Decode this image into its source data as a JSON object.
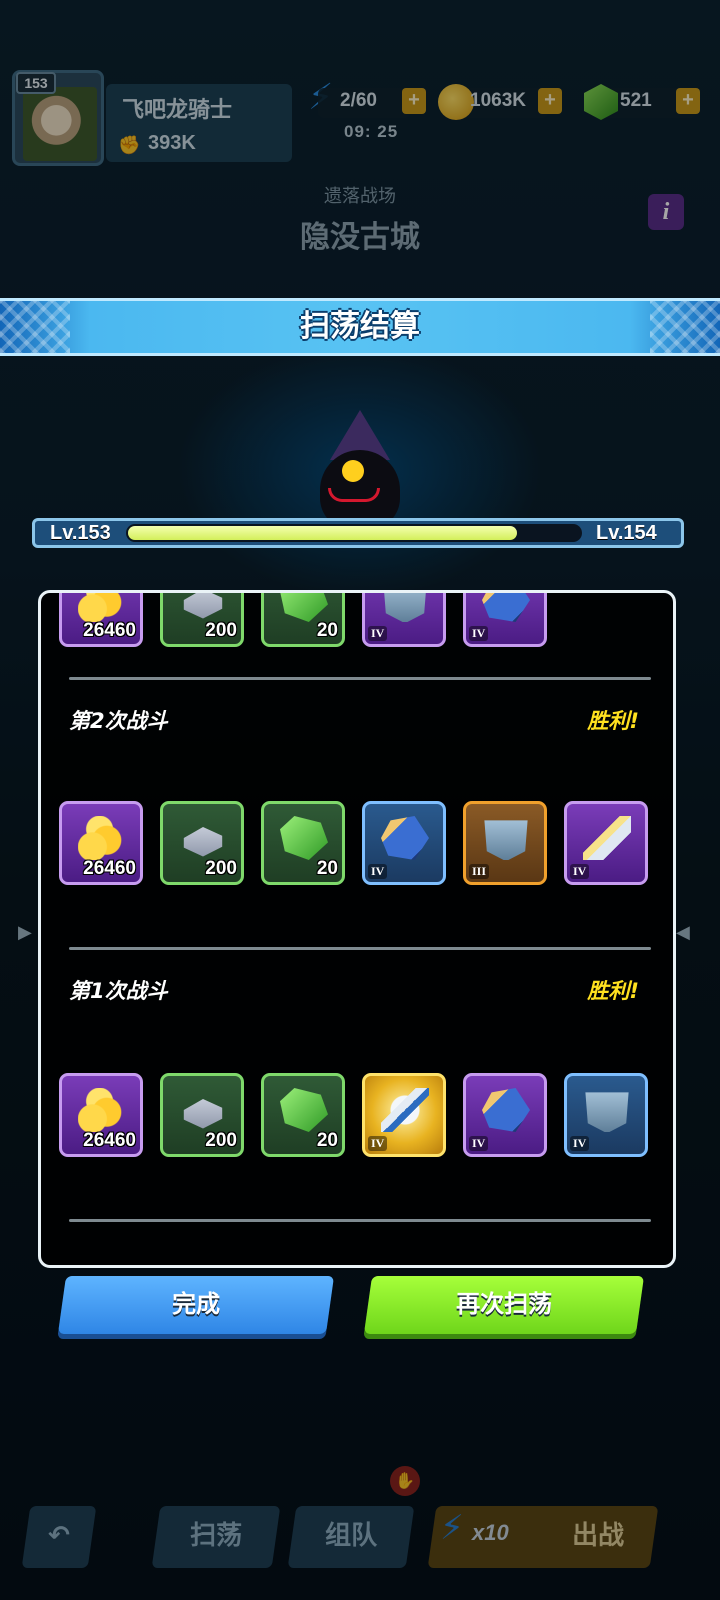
{
  "player": {
    "level": "153",
    "name": "飞吧龙骑士",
    "power": "393K"
  },
  "resources": {
    "energy": "2/60",
    "coins": "1063K",
    "gems": "521",
    "timer": "09: 25",
    "plus": "+"
  },
  "stage": {
    "category": "遗落战场",
    "name": "隐没古城"
  },
  "dialog": {
    "title": "扫荡结算",
    "xp": {
      "from": "Lv.153",
      "to": "Lv.154",
      "fill": 0.86
    },
    "battles": [
      {
        "label": "",
        "result": "",
        "items": [
          {
            "kind": "gold",
            "qty": "26460",
            "tier": ""
          },
          {
            "kind": "iron",
            "qty": "200",
            "tier": ""
          },
          {
            "kind": "gem",
            "qty": "20",
            "tier": ""
          },
          {
            "kind": "armor",
            "qty": "",
            "tier": "IV"
          },
          {
            "kind": "glove",
            "qty": "",
            "tier": "IV"
          }
        ]
      },
      {
        "label": "第2次战斗",
        "result": "胜利!",
        "items": [
          {
            "kind": "gold",
            "qty": "26460",
            "tier": ""
          },
          {
            "kind": "iron",
            "qty": "200",
            "tier": ""
          },
          {
            "kind": "gem",
            "qty": "20",
            "tier": ""
          },
          {
            "kind": "glove",
            "qty": "",
            "tier": "IV"
          },
          {
            "kind": "armor",
            "qty": "",
            "tier": "III"
          },
          {
            "kind": "sword",
            "qty": "",
            "tier": "IV"
          }
        ]
      },
      {
        "label": "第1次战斗",
        "result": "胜利!",
        "items": [
          {
            "kind": "gold",
            "qty": "26460",
            "tier": ""
          },
          {
            "kind": "iron",
            "qty": "200",
            "tier": ""
          },
          {
            "kind": "gem",
            "qty": "20",
            "tier": ""
          },
          {
            "kind": "axe",
            "qty": "",
            "tier": "IV"
          },
          {
            "kind": "glove",
            "qty": "",
            "tier": "IV"
          },
          {
            "kind": "armor",
            "qty": "",
            "tier": "IV"
          }
        ]
      }
    ],
    "buttons": {
      "done": "完成",
      "again": "再次扫荡"
    }
  },
  "nav": {
    "back_icon": "back-arrow-icon",
    "sweep": "扫荡",
    "team": "组队",
    "multiplier": "x10",
    "fight": "出战"
  },
  "colors": {
    "accent": "#58c3f3",
    "success": "#ffe11f",
    "confirm": "#6fd61b"
  }
}
